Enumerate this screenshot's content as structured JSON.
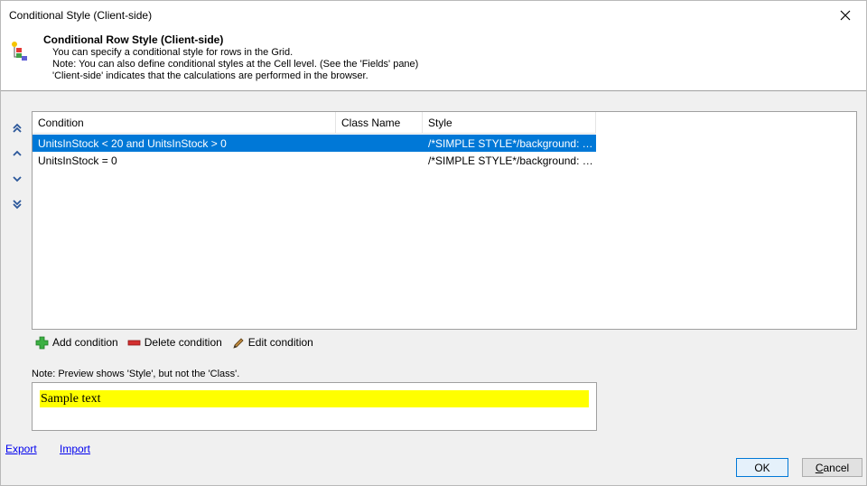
{
  "window": {
    "title": "Conditional Style (Client-side)"
  },
  "header": {
    "title": "Conditional Row Style (Client-side)",
    "lines": [
      "You can specify a conditional style for rows in the Grid.",
      "Note: You can also define conditional styles at the Cell level. (See the 'Fields' pane)",
      "'Client-side' indicates that the calculations are performed in the browser."
    ]
  },
  "grid": {
    "columns": [
      "Condition",
      "Class Name",
      "Style"
    ],
    "rows": [
      {
        "condition": "UnitsInStock < 20 and UnitsInStock > 0",
        "class_name": "",
        "style": "/*SIMPLE STYLE*/background: Y...",
        "selected": true
      },
      {
        "condition": "UnitsInStock = 0",
        "class_name": "",
        "style": "/*SIMPLE STYLE*/background: R...",
        "selected": false
      }
    ]
  },
  "toolbar": {
    "add_label": "Add condition",
    "delete_label": "Delete condition",
    "edit_label": "Edit condition"
  },
  "preview": {
    "note": "Note: Preview shows 'Style', but not the 'Class'.",
    "sample_text": "Sample text",
    "sample_background": "#ffff00"
  },
  "links": {
    "export": "Export",
    "import": "Import"
  },
  "buttons": {
    "ok": "OK",
    "cancel_prefix": "C",
    "cancel_rest": "ancel"
  },
  "colors": {
    "selection": "#0078d7",
    "link": "#0000ee",
    "move_arrows": "#2b579a"
  }
}
